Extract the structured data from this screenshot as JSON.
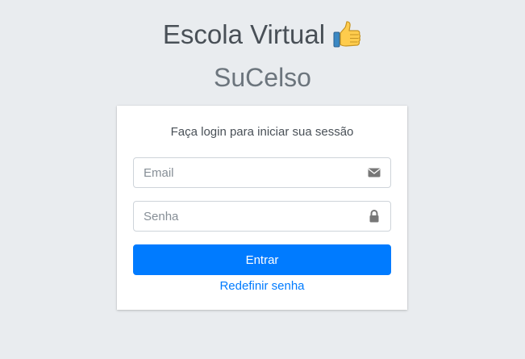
{
  "brand": {
    "title": "Escola Virtual",
    "icon": "thumbs-up-icon",
    "subtitle": "SuCelso"
  },
  "login": {
    "message": "Faça login para iniciar sua sessão",
    "email": {
      "placeholder": "Email",
      "value": "",
      "icon": "envelope-icon"
    },
    "password": {
      "placeholder": "Senha",
      "value": "",
      "icon": "lock-icon"
    },
    "submit_label": "Entrar",
    "reset_link": "Redefinir senha"
  },
  "colors": {
    "background": "#e9ecef",
    "primary": "#007bff",
    "card": "#ffffff",
    "text": "#495057",
    "icon": "#777777"
  }
}
